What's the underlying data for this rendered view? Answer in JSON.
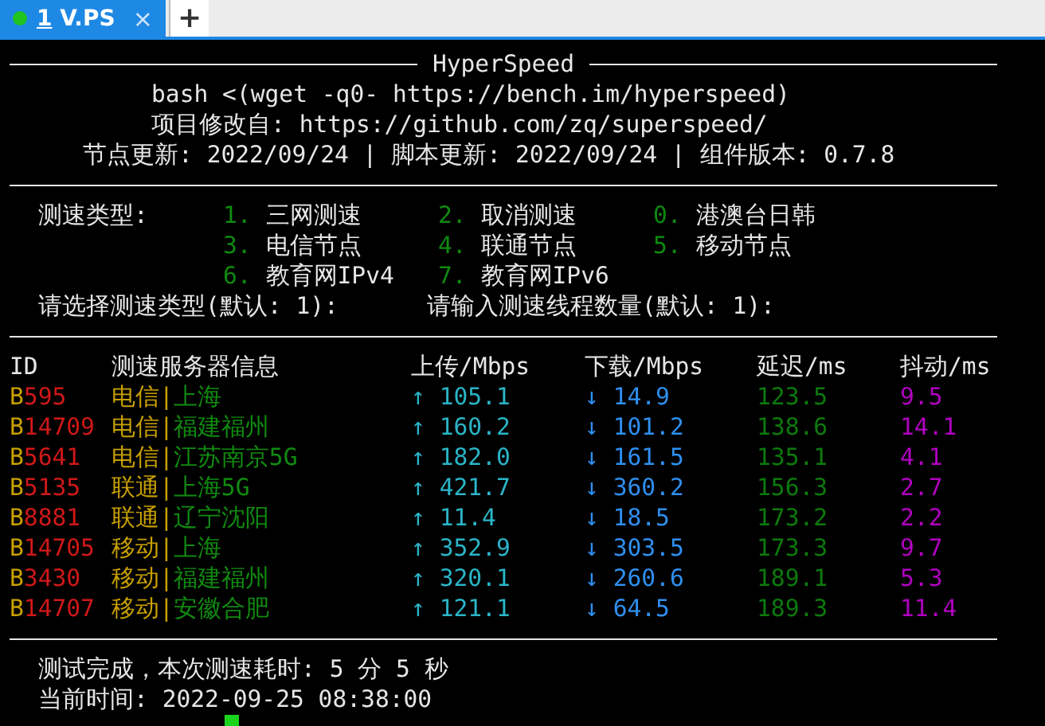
{
  "tabs": [
    {
      "number": "1",
      "label": "V.PS",
      "close": "×",
      "selected": true
    }
  ],
  "new_tab": "+",
  "banner": {
    "title": "HyperSpeed",
    "lines": [
      "bash <(wget -q0- https://bench.im/hyperspeed)",
      "项目修改自: https://github.com/zq/superspeed/",
      "节点更新: 2022/09/24 | 脚本更新: 2022/09/24 | 组件版本: 0.7.8"
    ]
  },
  "menu": {
    "label": "测速类型:",
    "options": [
      {
        "number": "1.",
        "label": "三网测速"
      },
      {
        "number": "2.",
        "label": "取消测速"
      },
      {
        "number": "0.",
        "label": "港澳台日韩"
      },
      {
        "number": "3.",
        "label": "电信节点"
      },
      {
        "number": "4.",
        "label": "联通节点"
      },
      {
        "number": "5.",
        "label": "移动节点"
      },
      {
        "number": "6.",
        "label": "教育网IPv4"
      },
      {
        "number": "7.",
        "label": "教育网IPv6"
      }
    ],
    "prompts": [
      "请选择测速类型(默认: 1):",
      "请输入测速线程数量(默认: 1):"
    ]
  },
  "table": {
    "columns": [
      "ID",
      "测速服务器信息",
      "上传/Mbps",
      "下载/Mbps",
      "延迟/ms",
      "抖动/ms"
    ],
    "rows": [
      {
        "id": "B595",
        "isp": "电信",
        "separator": "|",
        "location": "上海",
        "upload_arrow": "↑",
        "upload": "105.1",
        "download_arrow": "↓",
        "download": "14.9",
        "latency": "123.5",
        "jitter": "9.5"
      },
      {
        "id": "B14709",
        "isp": "电信",
        "separator": "|",
        "location": "福建福州",
        "upload_arrow": "↑",
        "upload": "160.2",
        "download_arrow": "↓",
        "download": "101.2",
        "latency": "138.6",
        "jitter": "14.1"
      },
      {
        "id": "B5641",
        "isp": "电信",
        "separator": "|",
        "location": "江苏南京5G",
        "upload_arrow": "↑",
        "upload": "182.0",
        "download_arrow": "↓",
        "download": "161.5",
        "latency": "135.1",
        "jitter": "4.1"
      },
      {
        "id": "B5135",
        "isp": "联通",
        "separator": "|",
        "location": "上海5G",
        "upload_arrow": "↑",
        "upload": "421.7",
        "download_arrow": "↓",
        "download": "360.2",
        "latency": "156.3",
        "jitter": "2.7"
      },
      {
        "id": "B8881",
        "isp": "联通",
        "separator": "|",
        "location": "辽宁沈阳",
        "upload_arrow": "↑",
        "upload": "11.4",
        "download_arrow": "↓",
        "download": "18.5",
        "latency": "173.2",
        "jitter": "2.2"
      },
      {
        "id": "B14705",
        "isp": "移动",
        "separator": "|",
        "location": "上海",
        "upload_arrow": "↑",
        "upload": "352.9",
        "download_arrow": "↓",
        "download": "303.5",
        "latency": "173.3",
        "jitter": "9.7"
      },
      {
        "id": "B3430",
        "isp": "移动",
        "separator": "|",
        "location": "福建福州",
        "upload_arrow": "↑",
        "upload": "320.1",
        "download_arrow": "↓",
        "download": "260.6",
        "latency": "189.1",
        "jitter": "5.3"
      },
      {
        "id": "B14707",
        "isp": "移动",
        "separator": "|",
        "location": "安徽合肥",
        "upload_arrow": "↑",
        "upload": "121.1",
        "download_arrow": "↓",
        "download": "64.5",
        "latency": "189.3",
        "jitter": "11.4"
      }
    ]
  },
  "summary": [
    "测试完成，本次测速耗时: 5 分 5 秒",
    "当前时间: 2022-09-25 08:38:00"
  ]
}
